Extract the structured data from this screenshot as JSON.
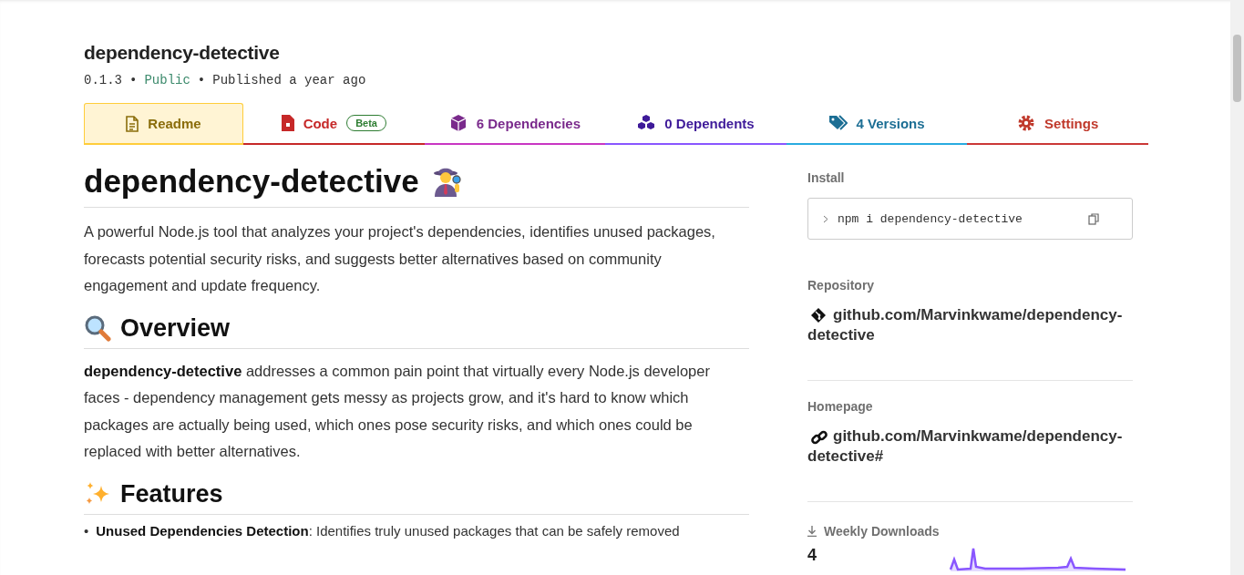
{
  "package": {
    "name": "dependency-detective",
    "version": "0.1.3",
    "visibility": "Public",
    "published": "Published a year ago",
    "separator": "•"
  },
  "tabs": [
    {
      "kind": "readme",
      "label": "Readme",
      "selected": true,
      "color": "#ffcd3a"
    },
    {
      "kind": "code",
      "label": "Code",
      "badge": "Beta",
      "selected": false,
      "color": "#c62828"
    },
    {
      "kind": "dependencies",
      "label": "6 Dependencies",
      "selected": false,
      "color": "#c836c3"
    },
    {
      "kind": "dependents",
      "label": "0 Dependents",
      "selected": false,
      "color": "#8956ff"
    },
    {
      "kind": "versions",
      "label": "4 Versions",
      "selected": false,
      "color": "#29abe0"
    },
    {
      "kind": "settings",
      "label": "Settings",
      "selected": false,
      "color": "#cb3837"
    }
  ],
  "readme": {
    "title": "dependency-detective",
    "intro": "A powerful Node.js tool that analyzes your project's dependencies, identifies unused packages, forecasts potential security risks, and suggests better alternatives based on community engagement and update frequency.",
    "sections": [
      {
        "kind": "overview",
        "heading": "Overview",
        "text": "**dependency-detective** addresses a common pain point that virtually every Node.js developer faces - dependency management gets messy as projects grow, and it's hard to know which packages are actually being used, which ones pose security risks, and which ones could be replaced with better alternatives."
      },
      {
        "kind": "features",
        "heading": "Features",
        "bullet": "•",
        "items": [
          "**Unused Dependencies Detection**: Identifies truly unused packages that can be safely removed"
        ]
      }
    ]
  },
  "sidebar": {
    "install": {
      "label": "Install",
      "command": "npm i dependency-detective"
    },
    "repository": {
      "label": "Repository",
      "link": "github.com/Marvinkwame/dependency-detective"
    },
    "homepage": {
      "label": "Homepage",
      "link": "github.com/Marvinkwame/dependency-detective#"
    },
    "downloads": {
      "label": "Weekly Downloads",
      "count": "4"
    }
  }
}
